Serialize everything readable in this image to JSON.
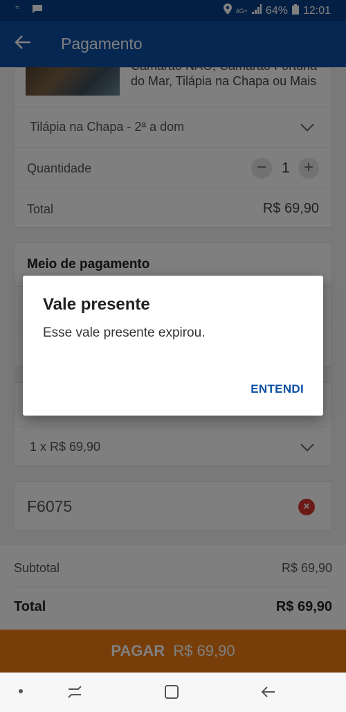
{
  "status_bar": {
    "time": "12:01",
    "battery": "64%",
    "network": "4G+"
  },
  "app_bar": {
    "title": "Pagamento"
  },
  "offer": {
    "description_line1": "Camarão NAO, Camarão Fortuna",
    "description_line2": "do Mar, Tilápia na Chapa ou Mais",
    "selected_option": "Tilápia na Chapa - 2ª a dom",
    "quantity_label": "Quantidade",
    "quantity_value": "1",
    "total_label": "Total",
    "total_value": "R$ 69,90"
  },
  "payment": {
    "section_title": "Meio de pagamento",
    "installments": "1 x R$ 69,90"
  },
  "voucher": {
    "code": "F6075"
  },
  "summary": {
    "subtotal_label": "Subtotal",
    "subtotal_value": "R$ 69,90",
    "total_label": "Total",
    "total_value": "R$ 69,90"
  },
  "pay_button": {
    "label": "PAGAR",
    "amount": "R$ 69,90"
  },
  "dialog": {
    "title": "Vale presente",
    "message": "Esse vale presente expirou.",
    "button": "ENTENDI"
  },
  "colors": {
    "primary": "#0a4fa3",
    "accent": "#f07c12",
    "error": "#d9342b"
  }
}
